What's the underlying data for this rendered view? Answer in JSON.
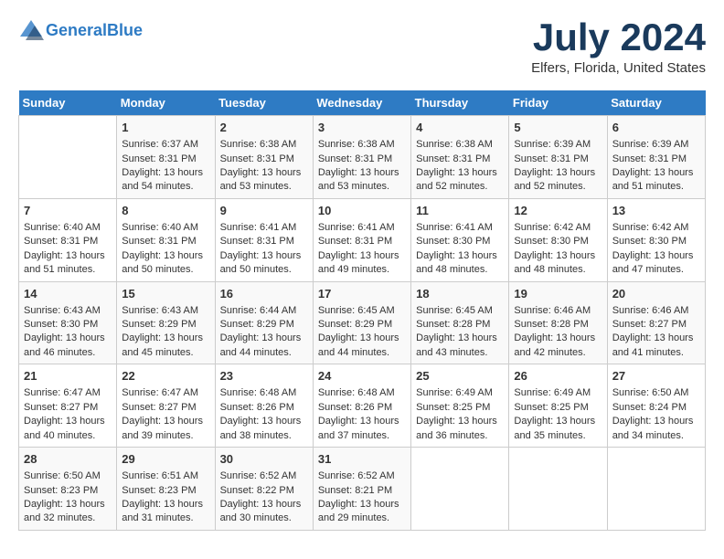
{
  "header": {
    "logo_line1": "General",
    "logo_line2": "Blue",
    "month": "July 2024",
    "location": "Elfers, Florida, United States"
  },
  "days_of_week": [
    "Sunday",
    "Monday",
    "Tuesday",
    "Wednesday",
    "Thursday",
    "Friday",
    "Saturday"
  ],
  "weeks": [
    [
      {
        "day": "",
        "sunrise": "",
        "sunset": "",
        "daylight": ""
      },
      {
        "day": "1",
        "sunrise": "Sunrise: 6:37 AM",
        "sunset": "Sunset: 8:31 PM",
        "daylight": "Daylight: 13 hours and 54 minutes."
      },
      {
        "day": "2",
        "sunrise": "Sunrise: 6:38 AM",
        "sunset": "Sunset: 8:31 PM",
        "daylight": "Daylight: 13 hours and 53 minutes."
      },
      {
        "day": "3",
        "sunrise": "Sunrise: 6:38 AM",
        "sunset": "Sunset: 8:31 PM",
        "daylight": "Daylight: 13 hours and 53 minutes."
      },
      {
        "day": "4",
        "sunrise": "Sunrise: 6:38 AM",
        "sunset": "Sunset: 8:31 PM",
        "daylight": "Daylight: 13 hours and 52 minutes."
      },
      {
        "day": "5",
        "sunrise": "Sunrise: 6:39 AM",
        "sunset": "Sunset: 8:31 PM",
        "daylight": "Daylight: 13 hours and 52 minutes."
      },
      {
        "day": "6",
        "sunrise": "Sunrise: 6:39 AM",
        "sunset": "Sunset: 8:31 PM",
        "daylight": "Daylight: 13 hours and 51 minutes."
      }
    ],
    [
      {
        "day": "7",
        "sunrise": "Sunrise: 6:40 AM",
        "sunset": "Sunset: 8:31 PM",
        "daylight": "Daylight: 13 hours and 51 minutes."
      },
      {
        "day": "8",
        "sunrise": "Sunrise: 6:40 AM",
        "sunset": "Sunset: 8:31 PM",
        "daylight": "Daylight: 13 hours and 50 minutes."
      },
      {
        "day": "9",
        "sunrise": "Sunrise: 6:41 AM",
        "sunset": "Sunset: 8:31 PM",
        "daylight": "Daylight: 13 hours and 50 minutes."
      },
      {
        "day": "10",
        "sunrise": "Sunrise: 6:41 AM",
        "sunset": "Sunset: 8:31 PM",
        "daylight": "Daylight: 13 hours and 49 minutes."
      },
      {
        "day": "11",
        "sunrise": "Sunrise: 6:41 AM",
        "sunset": "Sunset: 8:30 PM",
        "daylight": "Daylight: 13 hours and 48 minutes."
      },
      {
        "day": "12",
        "sunrise": "Sunrise: 6:42 AM",
        "sunset": "Sunset: 8:30 PM",
        "daylight": "Daylight: 13 hours and 48 minutes."
      },
      {
        "day": "13",
        "sunrise": "Sunrise: 6:42 AM",
        "sunset": "Sunset: 8:30 PM",
        "daylight": "Daylight: 13 hours and 47 minutes."
      }
    ],
    [
      {
        "day": "14",
        "sunrise": "Sunrise: 6:43 AM",
        "sunset": "Sunset: 8:30 PM",
        "daylight": "Daylight: 13 hours and 46 minutes."
      },
      {
        "day": "15",
        "sunrise": "Sunrise: 6:43 AM",
        "sunset": "Sunset: 8:29 PM",
        "daylight": "Daylight: 13 hours and 45 minutes."
      },
      {
        "day": "16",
        "sunrise": "Sunrise: 6:44 AM",
        "sunset": "Sunset: 8:29 PM",
        "daylight": "Daylight: 13 hours and 44 minutes."
      },
      {
        "day": "17",
        "sunrise": "Sunrise: 6:45 AM",
        "sunset": "Sunset: 8:29 PM",
        "daylight": "Daylight: 13 hours and 44 minutes."
      },
      {
        "day": "18",
        "sunrise": "Sunrise: 6:45 AM",
        "sunset": "Sunset: 8:28 PM",
        "daylight": "Daylight: 13 hours and 43 minutes."
      },
      {
        "day": "19",
        "sunrise": "Sunrise: 6:46 AM",
        "sunset": "Sunset: 8:28 PM",
        "daylight": "Daylight: 13 hours and 42 minutes."
      },
      {
        "day": "20",
        "sunrise": "Sunrise: 6:46 AM",
        "sunset": "Sunset: 8:27 PM",
        "daylight": "Daylight: 13 hours and 41 minutes."
      }
    ],
    [
      {
        "day": "21",
        "sunrise": "Sunrise: 6:47 AM",
        "sunset": "Sunset: 8:27 PM",
        "daylight": "Daylight: 13 hours and 40 minutes."
      },
      {
        "day": "22",
        "sunrise": "Sunrise: 6:47 AM",
        "sunset": "Sunset: 8:27 PM",
        "daylight": "Daylight: 13 hours and 39 minutes."
      },
      {
        "day": "23",
        "sunrise": "Sunrise: 6:48 AM",
        "sunset": "Sunset: 8:26 PM",
        "daylight": "Daylight: 13 hours and 38 minutes."
      },
      {
        "day": "24",
        "sunrise": "Sunrise: 6:48 AM",
        "sunset": "Sunset: 8:26 PM",
        "daylight": "Daylight: 13 hours and 37 minutes."
      },
      {
        "day": "25",
        "sunrise": "Sunrise: 6:49 AM",
        "sunset": "Sunset: 8:25 PM",
        "daylight": "Daylight: 13 hours and 36 minutes."
      },
      {
        "day": "26",
        "sunrise": "Sunrise: 6:49 AM",
        "sunset": "Sunset: 8:25 PM",
        "daylight": "Daylight: 13 hours and 35 minutes."
      },
      {
        "day": "27",
        "sunrise": "Sunrise: 6:50 AM",
        "sunset": "Sunset: 8:24 PM",
        "daylight": "Daylight: 13 hours and 34 minutes."
      }
    ],
    [
      {
        "day": "28",
        "sunrise": "Sunrise: 6:50 AM",
        "sunset": "Sunset: 8:23 PM",
        "daylight": "Daylight: 13 hours and 32 minutes."
      },
      {
        "day": "29",
        "sunrise": "Sunrise: 6:51 AM",
        "sunset": "Sunset: 8:23 PM",
        "daylight": "Daylight: 13 hours and 31 minutes."
      },
      {
        "day": "30",
        "sunrise": "Sunrise: 6:52 AM",
        "sunset": "Sunset: 8:22 PM",
        "daylight": "Daylight: 13 hours and 30 minutes."
      },
      {
        "day": "31",
        "sunrise": "Sunrise: 6:52 AM",
        "sunset": "Sunset: 8:21 PM",
        "daylight": "Daylight: 13 hours and 29 minutes."
      },
      {
        "day": "",
        "sunrise": "",
        "sunset": "",
        "daylight": ""
      },
      {
        "day": "",
        "sunrise": "",
        "sunset": "",
        "daylight": ""
      },
      {
        "day": "",
        "sunrise": "",
        "sunset": "",
        "daylight": ""
      }
    ]
  ]
}
